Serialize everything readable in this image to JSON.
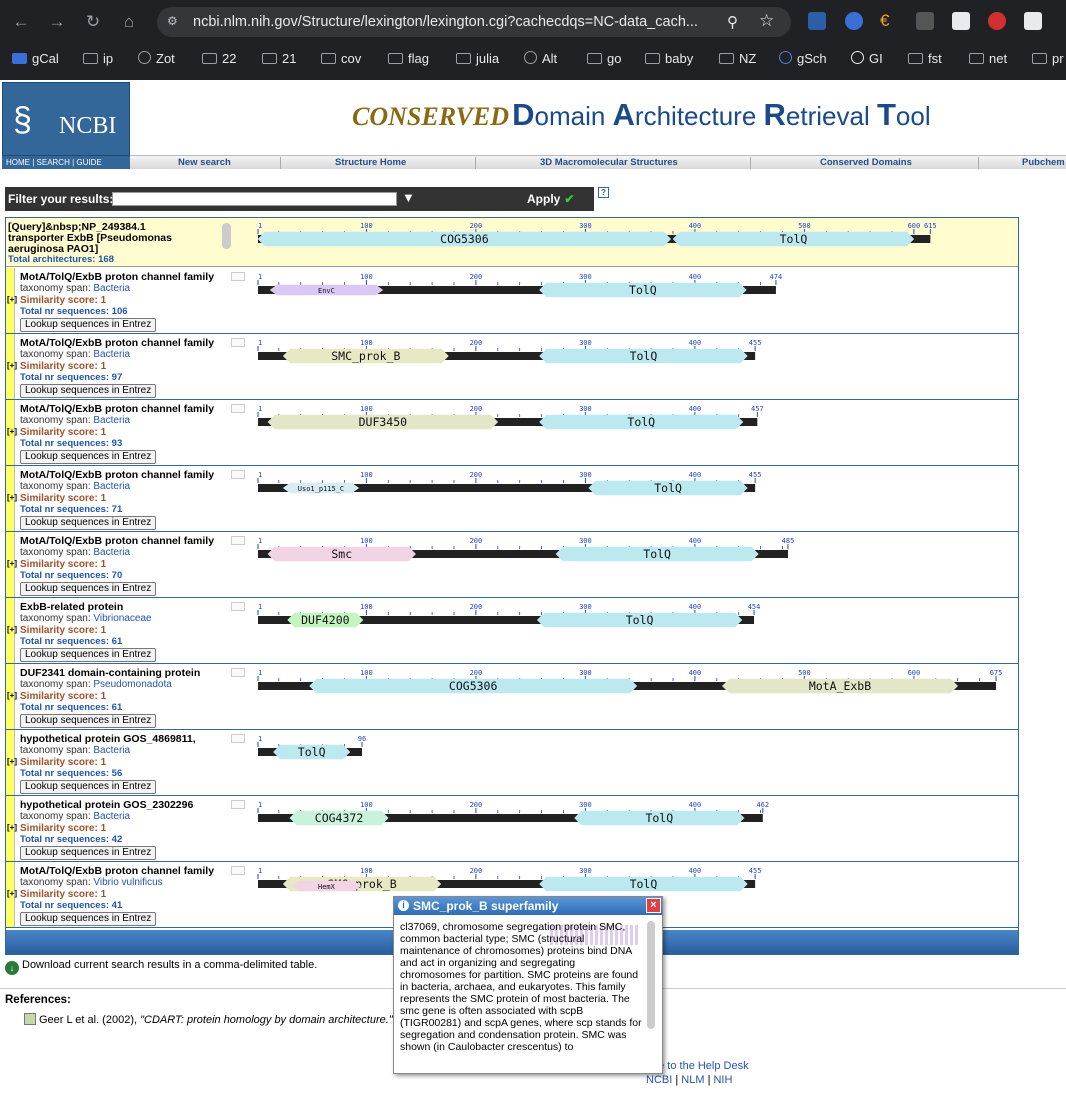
{
  "browser": {
    "url": "ncbi.nlm.nih.gov/Structure/lexington/lexington.cgi?cachecdqs=NC-data_cach...",
    "bookmarks": [
      "gCal",
      "ip",
      "Zot",
      "22",
      "21",
      "cov",
      "flag",
      "julia",
      "Alt",
      "go",
      "baby",
      "NZ",
      "gSch",
      "GI",
      "fst",
      "net",
      "pr"
    ]
  },
  "header": {
    "logo_text": "NCBI",
    "logo_links": "HOME | SEARCH | GUIDE",
    "title_conserved": "CONSERVED",
    "title_d": "D",
    "title_domain": "omain ",
    "title_a": "A",
    "title_architecture": "rchitecture ",
    "title_r": "R",
    "title_retrieval": "etrieval ",
    "title_t": "T",
    "title_tool": "ool",
    "nav": [
      "New search",
      "Structure Home",
      "3D Macromolecular Structures",
      "Conserved Domains",
      "Pubchem"
    ]
  },
  "filter": {
    "label": "Filter your results:",
    "value": "",
    "apply_label": "Apply"
  },
  "query": {
    "title_line1": "[Query]&nbsp;NP_249384.1",
    "title_line2": "transporter ExbB [Pseudomonas",
    "title_line3": "aeruginosa PAO1]",
    "total": "Total architectures: 168",
    "length": 615,
    "ticks": [
      1,
      100,
      200,
      300,
      400,
      500,
      615
    ],
    "domains": [
      {
        "name": "COG5306",
        "start": 1,
        "end": 378,
        "color": "#bce9ef"
      },
      {
        "name": "TolQ",
        "start": 380,
        "end": 600,
        "color": "#bce9ef"
      }
    ]
  },
  "results": [
    {
      "title": "MotA/TolQ/ExbB proton channel family",
      "tax_label": "taxonomy span:",
      "tax": "Bacteria",
      "sim": "Similarity score: 1",
      "total": "Total nr sequences: 106",
      "length": 474,
      "domains": [
        {
          "name": "EnvC",
          "start": 12,
          "end": 115,
          "color": "#dcc8f4",
          "small": true
        },
        {
          "name": "TolQ",
          "start": 258,
          "end": 447,
          "color": "#bce9ef"
        }
      ]
    },
    {
      "title": "MotA/TolQ/ExbB proton channel family",
      "tax_label": "taxonomy span:",
      "tax": "Bacteria",
      "sim": "Similarity score: 1",
      "total": "Total nr sequences: 97",
      "length": 455,
      "domains": [
        {
          "name": "SMC_prok_B",
          "start": 24,
          "end": 175,
          "color": "#e8e9c4"
        },
        {
          "name": "TolQ",
          "start": 258,
          "end": 448,
          "color": "#bce9ef"
        }
      ]
    },
    {
      "title": "MotA/TolQ/ExbB proton channel family",
      "tax_label": "taxonomy span:",
      "tax": "Bacteria",
      "sim": "Similarity score: 1",
      "total": "Total nr sequences: 93",
      "length": 457,
      "domains": [
        {
          "name": "DUF3450",
          "start": 10,
          "end": 220,
          "color": "#e4e6c8"
        },
        {
          "name": "TolQ",
          "start": 258,
          "end": 444,
          "color": "#bce9ef"
        }
      ]
    },
    {
      "title": "MotA/TolQ/ExbB proton channel family",
      "tax_label": "taxonomy span:",
      "tax": "Bacteria",
      "sim": "Similarity score: 1",
      "total": "Total nr sequences: 71",
      "length": 455,
      "domains": [
        {
          "name": "Uso1_p115_C",
          "start": 24,
          "end": 93,
          "color": "#d8ecf4",
          "small": true
        },
        {
          "name": "TolQ",
          "start": 303,
          "end": 448,
          "color": "#bce9ef"
        }
      ]
    },
    {
      "title": "MotA/TolQ/ExbB proton channel family",
      "tax_label": "taxonomy span:",
      "tax": "Bacteria",
      "sim": "Similarity score: 1",
      "total": "Total nr sequences: 70",
      "length": 485,
      "domains": [
        {
          "name": "Smc",
          "start": 10,
          "end": 145,
          "color": "#f2d4e4"
        },
        {
          "name": "TolQ",
          "start": 273,
          "end": 458,
          "color": "#bce9ef"
        }
      ]
    },
    {
      "title": "ExbB-related protein",
      "tax_label": "taxonomy span:",
      "tax": "Vibrionaceae",
      "sim": "Similarity score: 1",
      "total": "Total nr sequences: 61",
      "length": 454,
      "domains": [
        {
          "name": "DUF4200",
          "start": 28,
          "end": 97,
          "color": "#c4f4c0"
        },
        {
          "name": "TolQ",
          "start": 256,
          "end": 443,
          "color": "#bce9ef"
        }
      ]
    },
    {
      "title": "DUF2341 domain-containing protein",
      "tax_label": "taxonomy span:",
      "tax": "Pseudomonadota",
      "sim": "Similarity score: 1",
      "total": "Total nr sequences: 61",
      "length": 675,
      "domains": [
        {
          "name": "COG5306",
          "start": 48,
          "end": 347,
          "color": "#bce9ef"
        },
        {
          "name": "MotA_ExbB",
          "start": 425,
          "end": 640,
          "color": "#e4e6c8"
        }
      ]
    },
    {
      "title": "hypothetical protein GOS_4869811,",
      "tax_label": "taxonomy span:",
      "tax": "Bacteria",
      "sim": "Similarity score: 1",
      "total": "Total nr sequences: 56",
      "length": 96,
      "domains": [
        {
          "name": "TolQ",
          "start": 15,
          "end": 85,
          "color": "#bce9ef"
        }
      ]
    },
    {
      "title": "hypothetical protein GOS_2302296",
      "tax_label": "taxonomy span:",
      "tax": "Bacteria",
      "sim": "Similarity score: 1",
      "total": "Total nr sequences: 42",
      "length": 462,
      "domains": [
        {
          "name": "COG4372",
          "start": 30,
          "end": 120,
          "color": "#c8f2dc"
        },
        {
          "name": "TolQ",
          "start": 290,
          "end": 445,
          "color": "#bce9ef"
        }
      ]
    },
    {
      "title": "MotA/TolQ/ExbB proton channel family",
      "tax_label": "taxonomy span:",
      "tax": "Vibrio vulnificus",
      "sim": "Similarity score: 1",
      "total": "Total nr sequences: 41",
      "length": 455,
      "domains": [
        {
          "name": "SMC_prok_B",
          "start": 24,
          "end": 168,
          "color": "#e8e9c4"
        },
        {
          "name": "HemX",
          "start": 32,
          "end": 95,
          "color": "#f2d4e4",
          "small": true,
          "stacked": true
        },
        {
          "name": "TolQ",
          "start": 258,
          "end": 448,
          "color": "#bce9ef"
        }
      ]
    }
  ],
  "lookup_label": "Lookup sequences in Entrez",
  "expander_label": "[+]",
  "download_text": "Download current search results in a comma-delimited table.",
  "references": {
    "heading": "References:",
    "item_author": "Geer L et al. (2002),",
    "item_title": "\"CDART: protein homology by domain architecture.\""
  },
  "footer": {
    "line1_a": "er",
    "line1_b": "Write to the Help Desk",
    "line2": [
      "NCBI",
      "NLM",
      "NIH"
    ]
  },
  "popup": {
    "title": "SMC_prok_B superfamily",
    "body": "cl37069, chromosome segregation protein SMC, common bacterial type; SMC (structural maintenance of chromosomes) proteins bind DNA and act in organizing and segregating chromosomes for partition. SMC proteins are found in bacteria, archaea, and eukaryotes. This family represents the SMC protein of most bacteria. The smc gene is often associated with scpB (TIGR00281) and scpA genes, where scp stands for segregation and condensation protein. SMC was shown (in Caulobacter crescentus) to"
  }
}
